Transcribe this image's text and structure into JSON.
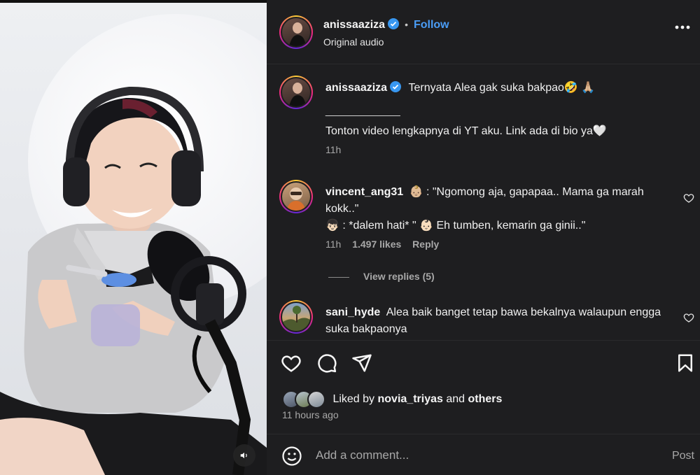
{
  "post": {
    "username": "anissaaziza",
    "separator": "•",
    "follow_label": "Follow",
    "audio_label": "Original audio"
  },
  "caption": {
    "username": "anissaaziza",
    "text": "Ternyata Alea gak suka bakpao🤣 🙏🏼",
    "divider": "____________",
    "text2": "Tonton video lengkapnya di YT aku. Link ada di bio ya🤍",
    "time": "11h"
  },
  "comments": [
    {
      "username": "vincent_ang31",
      "line1": "👶🏼 : \"Ngomong aja, gapapaa.. Mama ga marah kokk..\"",
      "line2": "👦🏻 : *dalem hati* \" 👶🏻 Eh tumben, kemarin ga ginii..\"",
      "time": "11h",
      "likes": "1.497 likes",
      "reply_label": "Reply",
      "view_replies": "View replies (5)"
    },
    {
      "username": "sani_hyde",
      "text": "Alea baik banget tetap bawa bekalnya walaupun engga suka bakpaonya"
    }
  ],
  "likes": {
    "prefix": "Liked by",
    "user": "novia_triyas",
    "and": "and",
    "others": "others"
  },
  "timestamp": "11 hours ago",
  "composer": {
    "placeholder": "Add a comment...",
    "post_label": "Post"
  },
  "colors": {
    "panel_bg": "#1e1e20",
    "accent_blue": "#4a9cf5",
    "verified_blue": "#3897f0",
    "muted_text": "#a8a8a8"
  }
}
